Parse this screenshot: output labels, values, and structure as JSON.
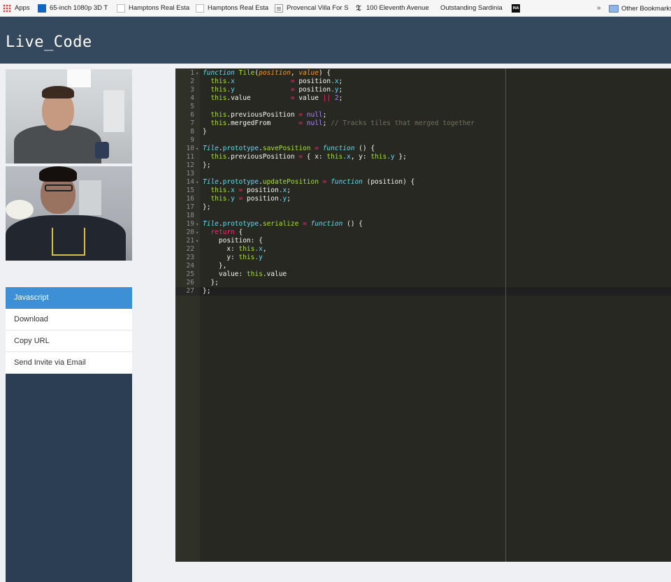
{
  "bookmarks": {
    "items": [
      {
        "label": "Apps",
        "icon": "apps-grid-icon"
      },
      {
        "label": "65-inch 1080p 3D T",
        "icon": "site-favicon"
      },
      {
        "label": "Hamptons Real Esta",
        "icon": "page-icon"
      },
      {
        "label": "Hamptons Real Esta",
        "icon": "page-icon"
      },
      {
        "label": "Provencal Villa For S",
        "icon": "page-icon"
      },
      {
        "label": "100 Eleventh Avenue",
        "icon": "nyt-icon"
      },
      {
        "label": "Outstanding Sardinia",
        "icon": "none"
      },
      {
        "label": "",
        "icon": "ina-icon"
      }
    ],
    "overflow": "»",
    "other_label": "Other Bookmarks"
  },
  "header": {
    "title": "Live_Code"
  },
  "menu": {
    "items": [
      "Javascript",
      "Download",
      "Copy URL",
      "Send Invite via Email"
    ],
    "active": "Javascript"
  },
  "editor": {
    "language": "javascript",
    "theme": "monokai",
    "active_line": 27,
    "fold_lines": [
      1,
      10,
      14,
      19,
      20,
      21
    ],
    "lines": [
      [
        [
          "kw",
          "function"
        ],
        [
          "t",
          " "
        ],
        [
          "fn",
          "Tile"
        ],
        [
          "t",
          "("
        ],
        [
          "pr",
          "position"
        ],
        [
          "t",
          ", "
        ],
        [
          "pr",
          "value"
        ],
        [
          "t",
          ") {"
        ]
      ],
      [
        [
          "t",
          "  "
        ],
        [
          "th",
          "this"
        ],
        [
          "pp",
          ".x"
        ],
        [
          "t",
          "              "
        ],
        [
          "op",
          "="
        ],
        [
          "t",
          " position"
        ],
        [
          "pp",
          ".x"
        ],
        [
          "t",
          ";"
        ]
      ],
      [
        [
          "t",
          "  "
        ],
        [
          "th",
          "this"
        ],
        [
          "pp",
          ".y"
        ],
        [
          "t",
          "              "
        ],
        [
          "op",
          "="
        ],
        [
          "t",
          " position"
        ],
        [
          "pp",
          ".y"
        ],
        [
          "t",
          ";"
        ]
      ],
      [
        [
          "t",
          "  "
        ],
        [
          "th",
          "this"
        ],
        [
          "t",
          ".value          "
        ],
        [
          "op",
          "="
        ],
        [
          "t",
          " value "
        ],
        [
          "op",
          "||"
        ],
        [
          "t",
          " "
        ],
        [
          "num",
          "2"
        ],
        [
          "t",
          ";"
        ]
      ],
      [
        [
          "t",
          ""
        ]
      ],
      [
        [
          "t",
          "  "
        ],
        [
          "th",
          "this"
        ],
        [
          "t",
          ".previousPosition "
        ],
        [
          "op",
          "="
        ],
        [
          "t",
          " "
        ],
        [
          "num",
          "null"
        ],
        [
          "t",
          ";"
        ]
      ],
      [
        [
          "t",
          "  "
        ],
        [
          "th",
          "this"
        ],
        [
          "t",
          ".mergedFrom       "
        ],
        [
          "op",
          "="
        ],
        [
          "t",
          " "
        ],
        [
          "num",
          "null"
        ],
        [
          "t",
          "; "
        ],
        [
          "cm",
          "// Tracks tiles that merged together"
        ]
      ],
      [
        [
          "t",
          "}"
        ]
      ],
      [
        [
          "t",
          ""
        ]
      ],
      [
        [
          "ty",
          "Tile"
        ],
        [
          "t",
          "."
        ],
        [
          "pp",
          "prototype"
        ],
        [
          "t",
          "."
        ],
        [
          "fn",
          "savePosition"
        ],
        [
          "t",
          " "
        ],
        [
          "op",
          "="
        ],
        [
          "t",
          " "
        ],
        [
          "kw",
          "function"
        ],
        [
          "t",
          " () {"
        ]
      ],
      [
        [
          "t",
          "  "
        ],
        [
          "th",
          "this"
        ],
        [
          "t",
          ".previousPosition "
        ],
        [
          "op",
          "="
        ],
        [
          "t",
          " { x: "
        ],
        [
          "th",
          "this"
        ],
        [
          "pp",
          ".x"
        ],
        [
          "t",
          ", y: "
        ],
        [
          "th",
          "this"
        ],
        [
          "pp",
          ".y"
        ],
        [
          "t",
          " };"
        ]
      ],
      [
        [
          "t",
          "};"
        ]
      ],
      [
        [
          "t",
          ""
        ]
      ],
      [
        [
          "ty",
          "Tile"
        ],
        [
          "t",
          "."
        ],
        [
          "pp",
          "prototype"
        ],
        [
          "t",
          "."
        ],
        [
          "fn",
          "updatePosition"
        ],
        [
          "t",
          " "
        ],
        [
          "op",
          "="
        ],
        [
          "t",
          " "
        ],
        [
          "kw",
          "function"
        ],
        [
          "t",
          " (position) {"
        ]
      ],
      [
        [
          "t",
          "  "
        ],
        [
          "th",
          "this"
        ],
        [
          "pp",
          ".x"
        ],
        [
          "t",
          " "
        ],
        [
          "op",
          "="
        ],
        [
          "t",
          " position"
        ],
        [
          "pp",
          ".x"
        ],
        [
          "t",
          ";"
        ]
      ],
      [
        [
          "t",
          "  "
        ],
        [
          "th",
          "this"
        ],
        [
          "pp",
          ".y"
        ],
        [
          "t",
          " "
        ],
        [
          "op",
          "="
        ],
        [
          "t",
          " position"
        ],
        [
          "pp",
          ".y"
        ],
        [
          "t",
          ";"
        ]
      ],
      [
        [
          "t",
          "};"
        ]
      ],
      [
        [
          "t",
          ""
        ]
      ],
      [
        [
          "ty",
          "Tile"
        ],
        [
          "t",
          "."
        ],
        [
          "pp",
          "prototype"
        ],
        [
          "t",
          "."
        ],
        [
          "fn",
          "serialize"
        ],
        [
          "t",
          " "
        ],
        [
          "op",
          "="
        ],
        [
          "t",
          " "
        ],
        [
          "kw",
          "function"
        ],
        [
          "t",
          " () {"
        ]
      ],
      [
        [
          "t",
          "  "
        ],
        [
          "op",
          "return"
        ],
        [
          "t",
          " {"
        ]
      ],
      [
        [
          "t",
          "    position: {"
        ]
      ],
      [
        [
          "t",
          "      x: "
        ],
        [
          "th",
          "this"
        ],
        [
          "pp",
          ".x"
        ],
        [
          "t",
          ","
        ]
      ],
      [
        [
          "t",
          "      y: "
        ],
        [
          "th",
          "this"
        ],
        [
          "pp",
          ".y"
        ]
      ],
      [
        [
          "t",
          "    },"
        ]
      ],
      [
        [
          "t",
          "    value: "
        ],
        [
          "th",
          "this"
        ],
        [
          "t",
          ".value"
        ]
      ],
      [
        [
          "t",
          "  };"
        ]
      ],
      [
        [
          "t",
          "};"
        ]
      ]
    ]
  }
}
